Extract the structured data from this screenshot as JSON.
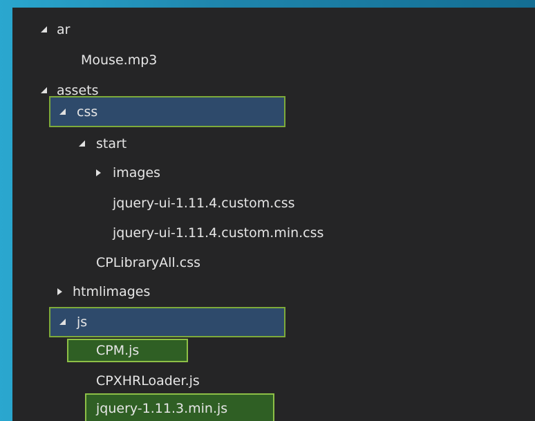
{
  "explorer": {
    "items": [
      {
        "label": "ar",
        "icon": "expanded-arrow-icon"
      },
      {
        "label": "Mouse.mp3"
      },
      {
        "label": "assets",
        "icon": "expanded-arrow-icon"
      },
      {
        "label": "css",
        "icon": "expanded-arrow-icon",
        "highlight": "selected"
      },
      {
        "label": "start",
        "icon": "expanded-arrow-icon"
      },
      {
        "label": "images",
        "icon": "collapsed-arrow-icon"
      },
      {
        "label": "jquery-ui-1.11.4.custom.css"
      },
      {
        "label": "jquery-ui-1.11.4.custom.min.css"
      },
      {
        "label": "CPLibraryAll.css"
      },
      {
        "label": "htmlimages",
        "icon": "collapsed-arrow-icon"
      },
      {
        "label": "js",
        "icon": "expanded-arrow-icon",
        "highlight": "selected"
      },
      {
        "label": "CPM.js",
        "highlight": "marked"
      },
      {
        "label": "CPXHRLoader.js"
      },
      {
        "label": "jquery-1.11.3.min.js",
        "highlight": "marked"
      }
    ]
  },
  "colors": {
    "panel_background": "#252526",
    "selected_row": "#2e4a6b",
    "marked_row": "#2f5f24",
    "highlight_border": "#7eab3a"
  }
}
